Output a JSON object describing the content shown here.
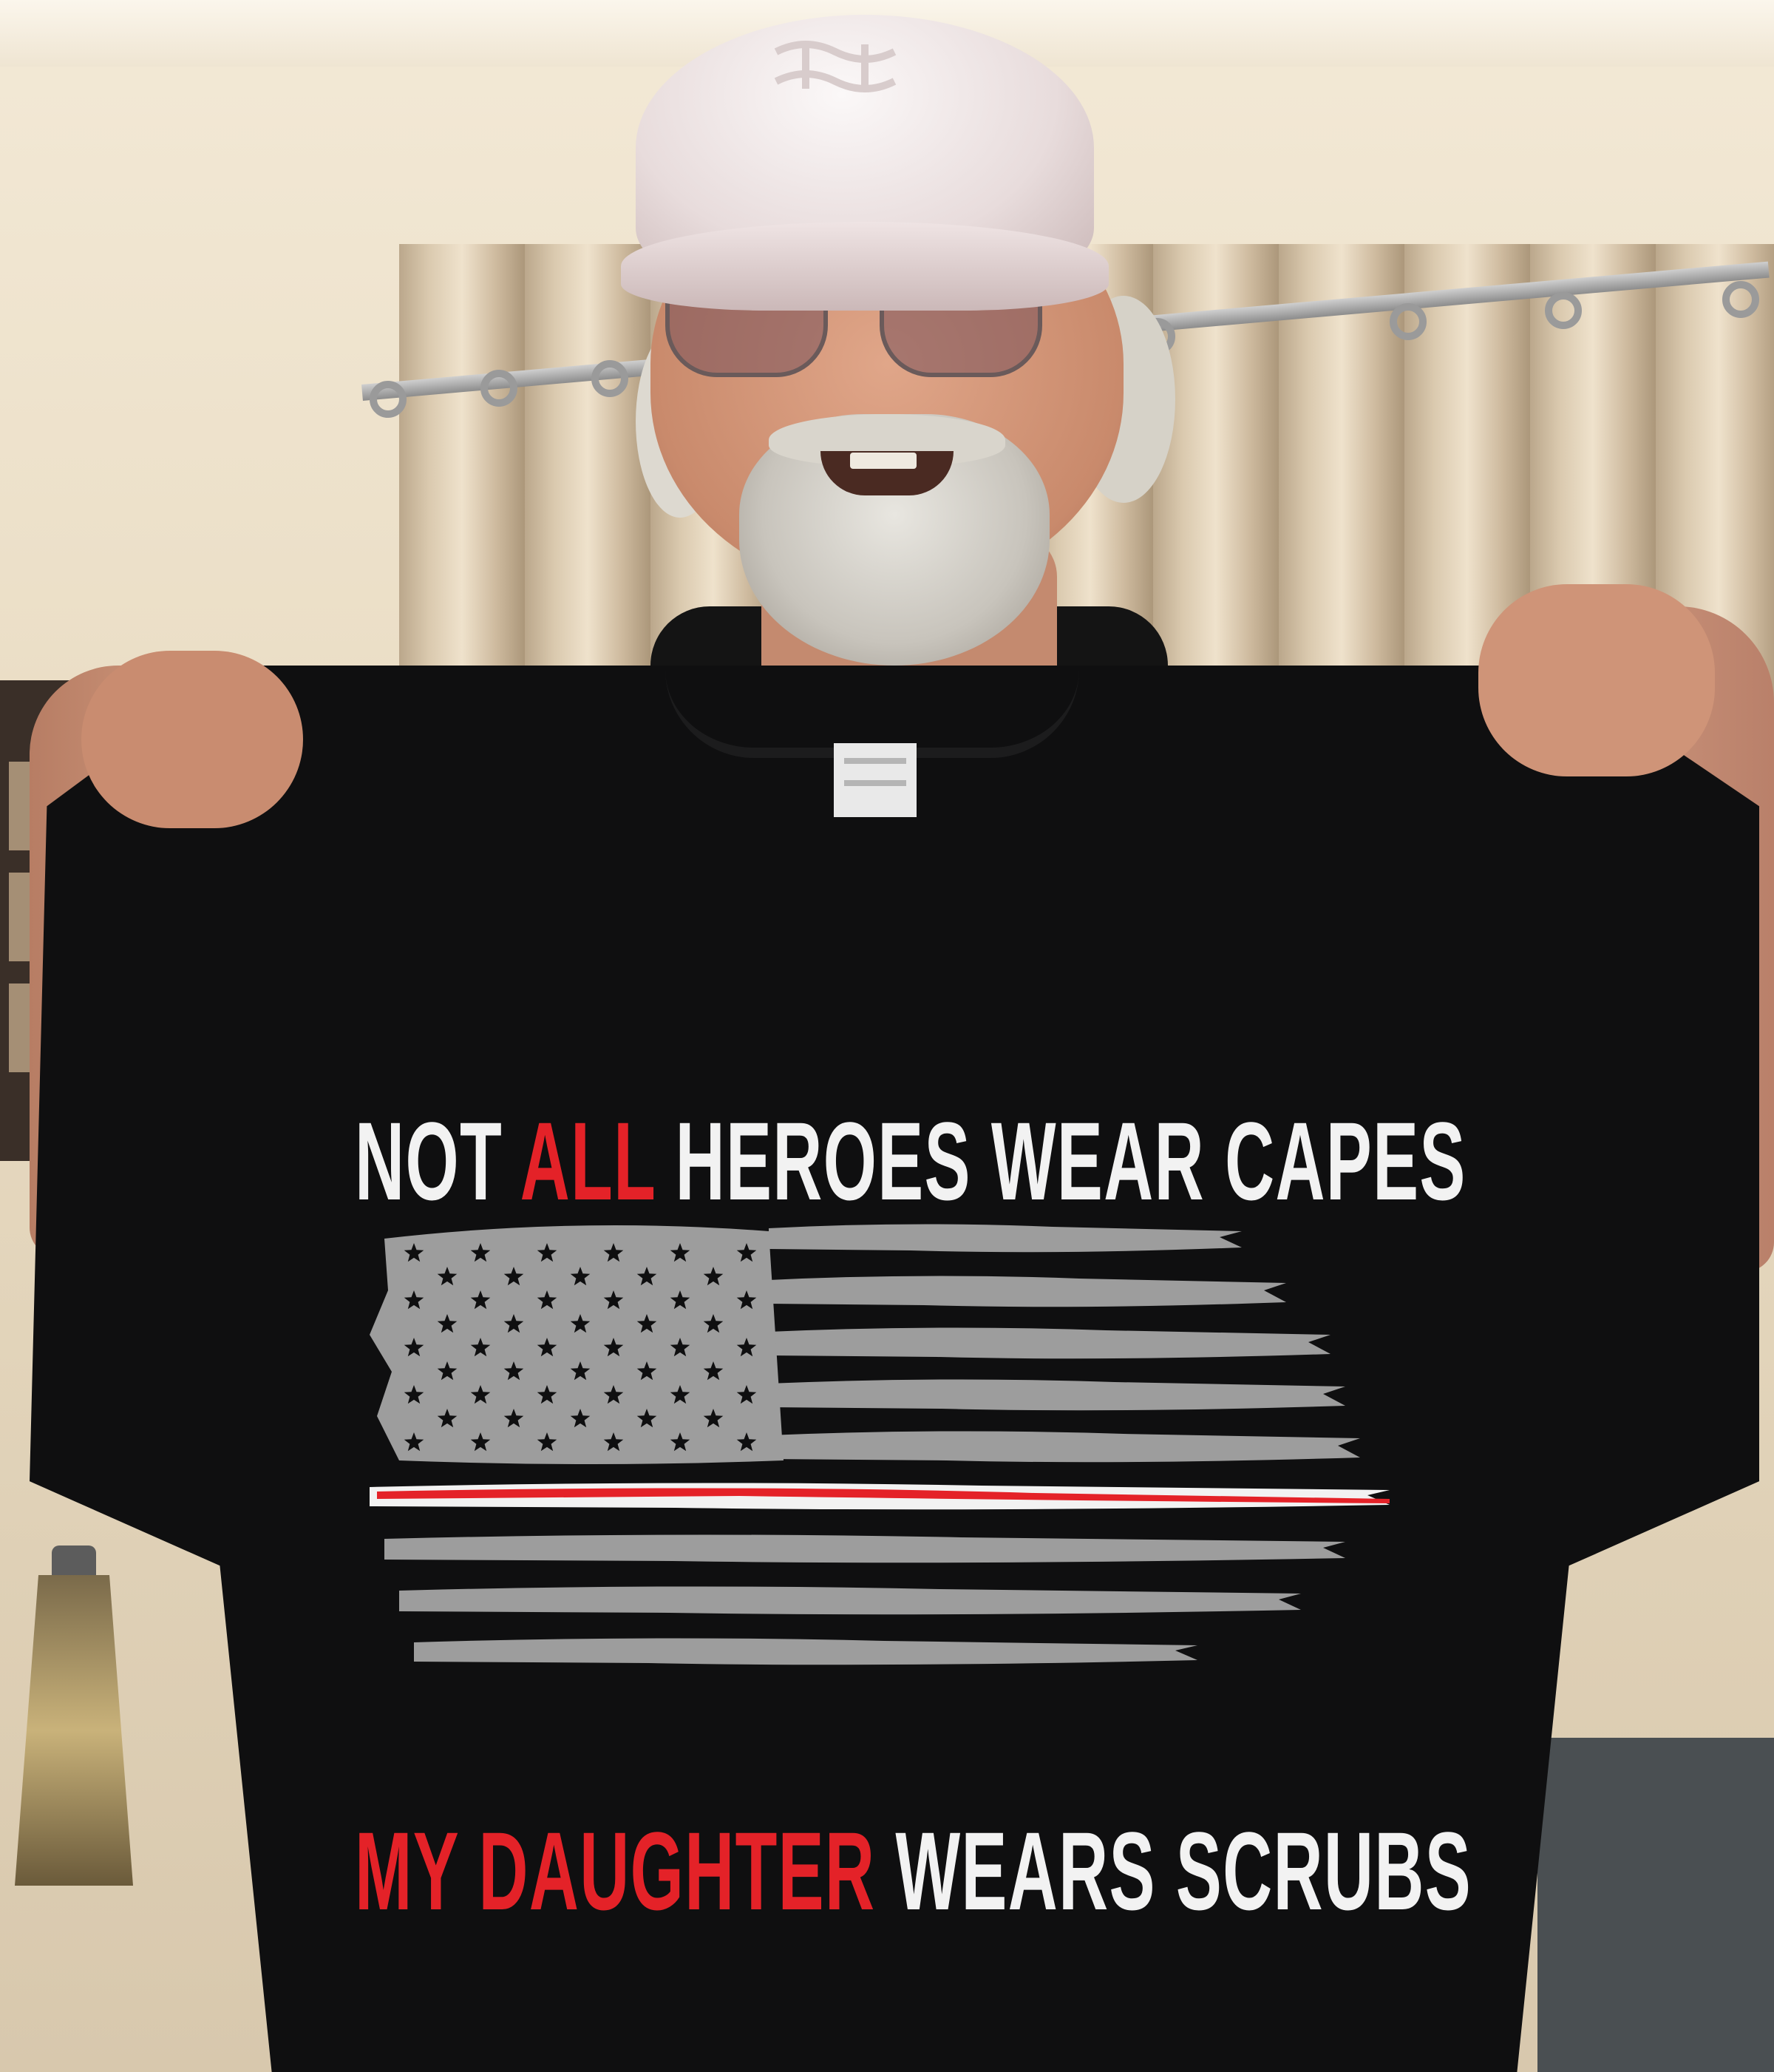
{
  "shirt_print": {
    "line1": {
      "part1": "NOT",
      "part2": "ALL",
      "part3": "HEROES WEAR CAPES"
    },
    "line2": {
      "part1": "MY DAUGHTER",
      "part2": "WEARS SCRUBS"
    }
  },
  "colors": {
    "shirt": "#0f0f10",
    "print_white": "#f2f2f2",
    "print_red": "#e42228",
    "flag_gray": "#9d9d9d"
  },
  "icons": {
    "cap_logo": "brand-logo",
    "flag": "distressed-american-flag-icon"
  }
}
